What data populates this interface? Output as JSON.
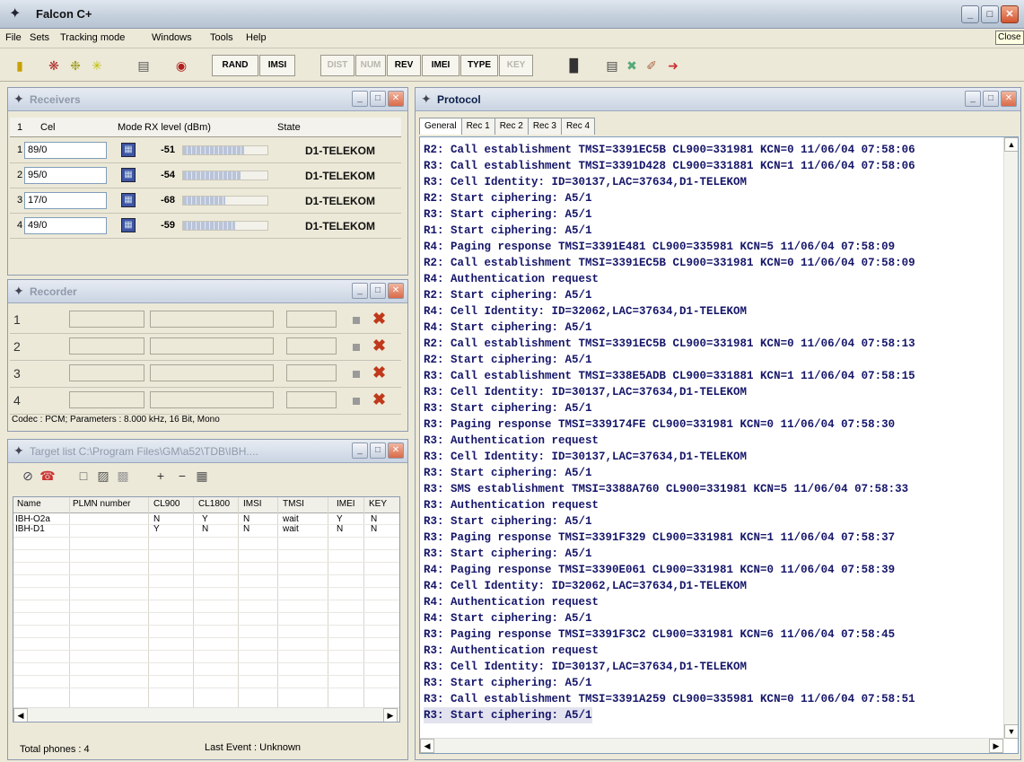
{
  "app": {
    "title": "Falcon C+",
    "close_tooltip": "Close"
  },
  "menu": [
    "File",
    "Sets",
    "Tracking mode",
    "Windows",
    "Tools",
    "Help"
  ],
  "toolbar": {
    "rand": "RAND",
    "imsi": "IMSI",
    "dist": "DIST",
    "num": "NUM",
    "rev": "REV",
    "imei": "IMEI",
    "type": "TYPE",
    "key": "KEY"
  },
  "receivers": {
    "title": "Receivers",
    "headers": [
      "1",
      "Cel",
      "Mode",
      "RX level (dBm)",
      "State"
    ],
    "rows": [
      {
        "num": "1",
        "cel": "89/0",
        "rx": "-51",
        "level": 0.72,
        "state": "D1-TELEKOM"
      },
      {
        "num": "2",
        "cel": "95/0",
        "rx": "-54",
        "level": 0.68,
        "state": "D1-TELEKOM"
      },
      {
        "num": "3",
        "cel": "17/0",
        "rx": "-68",
        "level": 0.5,
        "state": "D1-TELEKOM"
      },
      {
        "num": "4",
        "cel": "49/0",
        "rx": "-59",
        "level": 0.62,
        "state": "D1-TELEKOM"
      }
    ]
  },
  "recorder": {
    "title": "Recorder",
    "rows": [
      "1",
      "2",
      "3",
      "4"
    ],
    "codec": "Codec : PCM; Parameters : 8.000 kHz, 16 Bit, Mono"
  },
  "targets": {
    "title": "Target list C:\\Program Files\\GM\\a52\\TDB\\IBH....",
    "headers": [
      "Name",
      "PLMN number",
      "CL900",
      "CL1800",
      "IMSI",
      "TMSI",
      "IMEI",
      "KEY"
    ],
    "rows": [
      [
        "IBH-O2a",
        "",
        "N",
        "Y",
        "N",
        "wait",
        "Y",
        "N"
      ],
      [
        "IBH-D1",
        "",
        "Y",
        "N",
        "N",
        "wait",
        "N",
        "N"
      ]
    ],
    "total": "Total phones : 4",
    "last_event": "Last Event : Unknown"
  },
  "protocol": {
    "title": "Protocol",
    "tabs": [
      "General",
      "Rec 1",
      "Rec 2",
      "Rec 3",
      "Rec 4"
    ],
    "lines": [
      "R2: Call establishment TMSI=3391EC5B CL900=331981 KCN=0 11/06/04 07:58:06",
      "R3: Call establishment TMSI=3391D428 CL900=331881 KCN=1 11/06/04 07:58:06",
      "R3: Cell Identity: ID=30137,LAC=37634,D1-TELEKOM",
      "R2: Start ciphering: A5/1",
      "R3: Start ciphering: A5/1",
      "R1: Start ciphering: A5/1",
      "R4: Paging response TMSI=3391E481 CL900=335981 KCN=5 11/06/04 07:58:09",
      "R2: Call establishment TMSI=3391EC5B CL900=331981 KCN=0 11/06/04 07:58:09",
      "R4: Authentication request",
      "R2: Start ciphering: A5/1",
      "R4: Cell Identity: ID=32062,LAC=37634,D1-TELEKOM",
      "R4: Start ciphering: A5/1",
      "R2: Call establishment TMSI=3391EC5B CL900=331981 KCN=0 11/06/04 07:58:13",
      "R2: Start ciphering: A5/1",
      "R3: Call establishment TMSI=338E5ADB CL900=331881 KCN=1 11/06/04 07:58:15",
      "R3: Cell Identity: ID=30137,LAC=37634,D1-TELEKOM",
      "R3: Start ciphering: A5/1",
      "R3: Paging response TMSI=339174FE CL900=331981 KCN=0 11/06/04 07:58:30",
      "R3: Authentication request",
      "R3: Cell Identity: ID=30137,LAC=37634,D1-TELEKOM",
      "R3: Start ciphering: A5/1",
      "R3: SMS establishment TMSI=3388A760 CL900=331981 KCN=5 11/06/04 07:58:33",
      "R3: Authentication request",
      "R3: Start ciphering: A5/1",
      "R3: Paging response TMSI=3391F329 CL900=331981 KCN=1 11/06/04 07:58:37",
      "R3: Start ciphering: A5/1",
      "R4: Paging response TMSI=3390E061 CL900=331981 KCN=0 11/06/04 07:58:39",
      "R4: Cell Identity: ID=32062,LAC=37634,D1-TELEKOM",
      "R4: Authentication request",
      "R4: Start ciphering: A5/1",
      "R3: Paging response TMSI=3391F3C2 CL900=331981 KCN=6 11/06/04 07:58:45",
      "R3: Authentication request",
      "R3: Cell Identity: ID=30137,LAC=37634,D1-TELEKOM",
      "R3: Start ciphering: A5/1",
      "R3: Call establishment TMSI=3391A259 CL900=335981 KCN=0 11/06/04 07:58:51",
      "R3: Start ciphering: A5/1"
    ]
  }
}
